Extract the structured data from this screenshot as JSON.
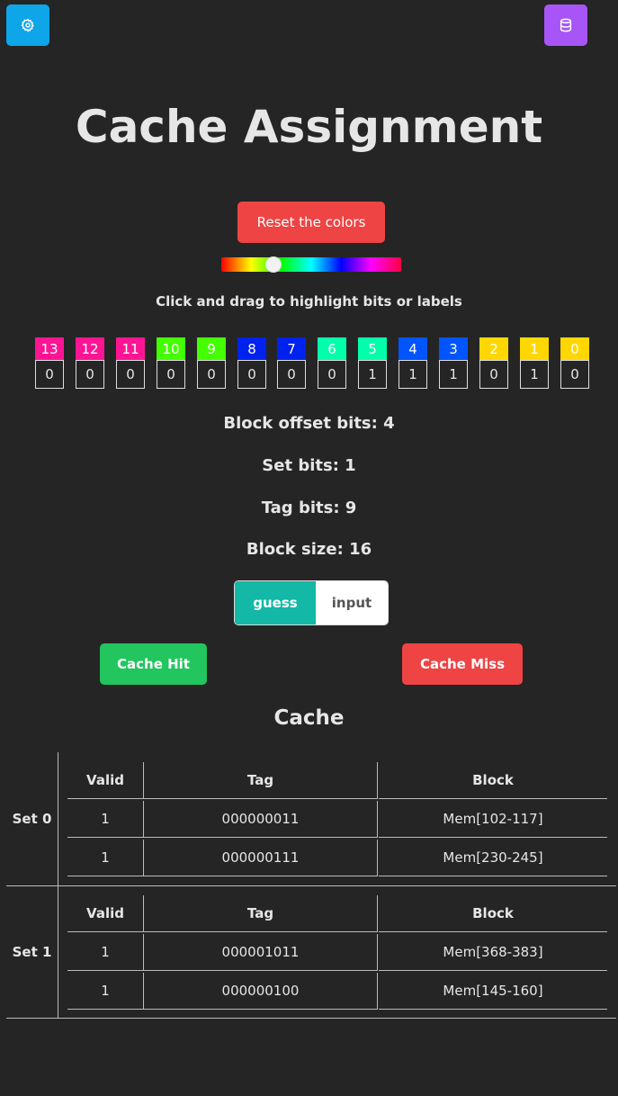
{
  "toolbar": {
    "settings_icon": "gear-icon",
    "database_icon": "database-icon"
  },
  "title": "Cache Assignment",
  "reset_label": "Reset the colors",
  "hue_slider": {
    "value_fraction": 0.29
  },
  "instructions": "Click and drag to highlight bits or labels",
  "bits": [
    {
      "label": "13",
      "value": "0",
      "color": "#ff1493"
    },
    {
      "label": "12",
      "value": "0",
      "color": "#ff1493"
    },
    {
      "label": "11",
      "value": "0",
      "color": "#ff1493"
    },
    {
      "label": "10",
      "value": "0",
      "color": "#44ff00"
    },
    {
      "label": "9",
      "value": "0",
      "color": "#44ff00"
    },
    {
      "label": "8",
      "value": "0",
      "color": "#0022ee"
    },
    {
      "label": "7",
      "value": "0",
      "color": "#0022ee"
    },
    {
      "label": "6",
      "value": "0",
      "color": "#00ffaa"
    },
    {
      "label": "5",
      "value": "1",
      "color": "#00ffaa"
    },
    {
      "label": "4",
      "value": "1",
      "color": "#0055ff"
    },
    {
      "label": "3",
      "value": "1",
      "color": "#0055ff"
    },
    {
      "label": "2",
      "value": "0",
      "color": "#ffd700"
    },
    {
      "label": "1",
      "value": "1",
      "color": "#ffd700"
    },
    {
      "label": "0",
      "value": "0",
      "color": "#ffd700"
    }
  ],
  "info": {
    "block_offset": "Block offset bits: 4",
    "set_bits": "Set bits: 1",
    "tag_bits": "Tag bits: 9",
    "block_size": "Block size: 16"
  },
  "mode": {
    "guess": "guess",
    "input": "input"
  },
  "actions": {
    "hit": "Cache Hit",
    "miss": "Cache Miss"
  },
  "cache": {
    "title": "Cache",
    "headers": {
      "valid": "Valid",
      "tag": "Tag",
      "block": "Block"
    },
    "sets": [
      {
        "label": "Set 0",
        "lines": [
          {
            "valid": "1",
            "tag": "000000011",
            "block": "Mem[102-117]"
          },
          {
            "valid": "1",
            "tag": "000000111",
            "block": "Mem[230-245]"
          }
        ]
      },
      {
        "label": "Set 1",
        "lines": [
          {
            "valid": "1",
            "tag": "000001011",
            "block": "Mem[368-383]"
          },
          {
            "valid": "1",
            "tag": "000000100",
            "block": "Mem[145-160]"
          }
        ]
      }
    ]
  }
}
